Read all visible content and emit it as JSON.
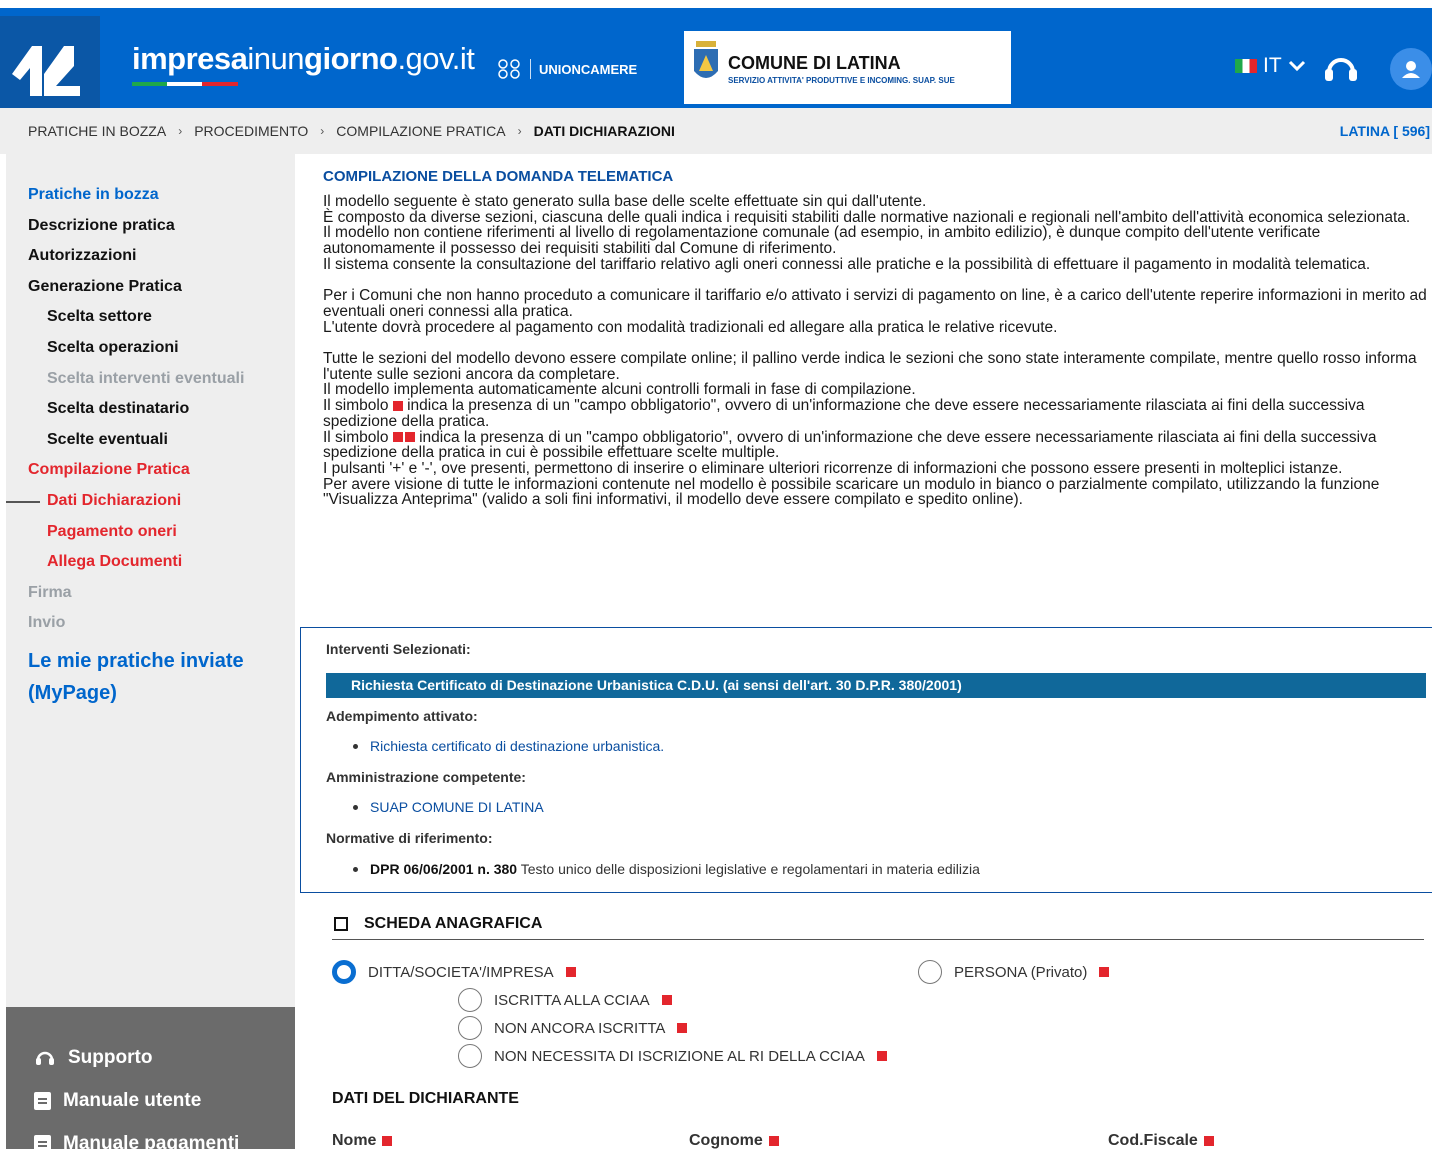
{
  "header": {
    "site_name_bold": "impresa",
    "site_name_mid": "inun",
    "site_name_bold2": "giorno",
    "site_name_tail": ".gov.it",
    "unioncamere": "UNIONCAMERE",
    "comune_title": "COMUNE DI LATINA",
    "comune_subtitle": "SERVIZIO ATTIVITA' PRODUTTIVE E INCOMING. SUAP. SUE",
    "language": "IT",
    "colors": {
      "primary": "#0066cc",
      "dark": "#0b57a6"
    }
  },
  "breadcrumb": {
    "items": [
      "PRATICHE IN BOZZA",
      "PROCEDIMENTO",
      "COMPILAZIONE PRATICA"
    ],
    "current": "DATI DICHIARAZIONI",
    "location": "LATINA [ 596]"
  },
  "sidebar": {
    "items": [
      {
        "label": "Pratiche in bozza"
      },
      {
        "label": "Descrizione pratica"
      },
      {
        "label": "Autorizzazioni"
      },
      {
        "label": "Generazione Pratica"
      },
      {
        "label": "Scelta settore"
      },
      {
        "label": "Scelta operazioni"
      },
      {
        "label": "Scelta interventi eventuali"
      },
      {
        "label": "Scelta destinatario"
      },
      {
        "label": "Scelte eventuali"
      },
      {
        "label": "Compilazione Pratica"
      },
      {
        "label": "Dati Dichiarazioni"
      },
      {
        "label": "Pagamento oneri"
      },
      {
        "label": "Allega Documenti"
      },
      {
        "label": "Firma"
      },
      {
        "label": "Invio"
      }
    ],
    "mypage": "Le mie pratiche inviate (MyPage)",
    "footer": {
      "supporto": "Supporto",
      "manuale_utente": "Manuale utente",
      "manuale_pagamenti": "Manuale pagamenti"
    }
  },
  "main": {
    "title": "COMPILAZIONE DELLA DOMANDA TELEMATICA",
    "p1": "Il modello seguente è stato generato sulla base delle scelte effettuate sin qui dall'utente.",
    "p2": "È composto da diverse sezioni, ciascuna delle quali indica i requisiti stabiliti dalle normative nazionali e regionali nell'ambito dell'attività economica selezionata.",
    "p3": "Il modello non contiene riferimenti al livello di regolamentazione comunale (ad esempio, in ambito edilizio), è dunque compito dell'utente verificate autonomamente il possesso dei requisiti stabiliti dal Comune di riferimento.",
    "p4": "Il sistema consente la consultazione del tariffario relativo agli oneri connessi alle pratiche e la possibilità di effettuare il pagamento in modalità telematica.",
    "p5": "Per i Comuni che non hanno proceduto a comunicare il tariffario e/o attivato i servizi di pagamento on line, è a carico dell'utente reperire informazioni in merito ad eventuali oneri connessi alla pratica.",
    "p6": "L'utente dovrà procedere al pagamento con modalità tradizionali ed allegare alla pratica le relative ricevute.",
    "p7": "Tutte le sezioni del modello devono essere compilate online; il pallino verde indica le sezioni che sono state interamente compilate, mentre quello rosso informa l'utente sulle sezioni ancora da completare.",
    "p8": "Il modello implementa automaticamente alcuni controlli formali in fase di compilazione.",
    "p9a": "Il simbolo",
    "p9b": "indica la presenza di un \"campo obbligatorio\", ovvero di un'informazione che deve essere necessariamente rilasciata ai fini della successiva spedizione della pratica.",
    "p10a": "Il simbolo",
    "p10b": "indica la presenza di un \"campo obbligatorio\", ovvero di un'informazione che deve essere necessariamente rilasciata ai fini della successiva spedizione della pratica in cui è possibile effettuare scelte multiple.",
    "p11": "I pulsanti '+' e '-', ove presenti, permettono di inserire o eliminare ulteriori ricorrenze di informazioni che possono essere presenti in molteplici istanze.",
    "p12": "Per avere visione di tutte le informazioni contenute nel modello è possibile scaricare un modulo in bianco o parzialmente compilato, utilizzando la funzione \"Visualizza Anteprima\" (valido a soli fini informativi, il modello deve essere compilato e spedito online)."
  },
  "interventi": {
    "label": "Interventi Selezionati:",
    "selected": "Richiesta Certificato di Destinazione Urbanistica C.D.U. (ai sensi dell'art. 30 D.P.R. 380/2001)",
    "adempimento_label": "Adempimento attivato:",
    "adempimento": "Richiesta certificato di destinazione urbanistica.",
    "amministrazione_label": "Amministrazione competente:",
    "amministrazione": "SUAP COMUNE DI LATINA",
    "normative_label": "Normative di riferimento:",
    "normativa_code": "DPR 06/06/2001 n. 380",
    "normativa_desc": "Testo unico delle disposizioni legislative e regolamentari in materia edilizia"
  },
  "scheda": {
    "title": "SCHEDA ANAGRAFICA",
    "opt_ditta": "DITTA/SOCIETA'/IMPRESA",
    "opt_persona": "PERSONA (Privato)",
    "opt_iscritta": "ISCRITTA ALLA CCIAA",
    "opt_non_iscritta": "NON ANCORA ISCRITTA",
    "opt_non_necessita": "NON NECESSITA DI ISCRIZIONE AL RI DELLA CCIAA",
    "dati_title": "DATI DEL DICHIARANTE",
    "nome": "Nome",
    "cognome": "Cognome",
    "codfiscale": "Cod.Fiscale",
    "required_color": "#e3262d"
  }
}
